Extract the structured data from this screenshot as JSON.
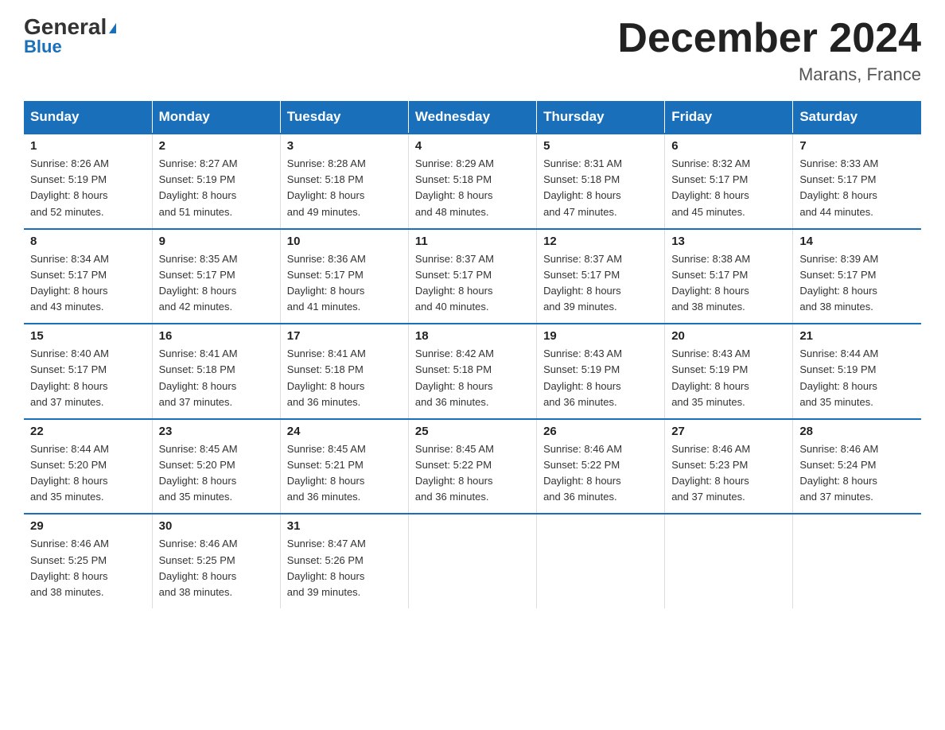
{
  "header": {
    "logo_line1": "General",
    "logo_line2": "Blue",
    "month_title": "December 2024",
    "location": "Marans, France"
  },
  "weekdays": [
    "Sunday",
    "Monday",
    "Tuesday",
    "Wednesday",
    "Thursday",
    "Friday",
    "Saturday"
  ],
  "weeks": [
    [
      {
        "day": "1",
        "sunrise": "Sunrise: 8:26 AM",
        "sunset": "Sunset: 5:19 PM",
        "daylight": "Daylight: 8 hours",
        "daylight2": "and 52 minutes."
      },
      {
        "day": "2",
        "sunrise": "Sunrise: 8:27 AM",
        "sunset": "Sunset: 5:19 PM",
        "daylight": "Daylight: 8 hours",
        "daylight2": "and 51 minutes."
      },
      {
        "day": "3",
        "sunrise": "Sunrise: 8:28 AM",
        "sunset": "Sunset: 5:18 PM",
        "daylight": "Daylight: 8 hours",
        "daylight2": "and 49 minutes."
      },
      {
        "day": "4",
        "sunrise": "Sunrise: 8:29 AM",
        "sunset": "Sunset: 5:18 PM",
        "daylight": "Daylight: 8 hours",
        "daylight2": "and 48 minutes."
      },
      {
        "day": "5",
        "sunrise": "Sunrise: 8:31 AM",
        "sunset": "Sunset: 5:18 PM",
        "daylight": "Daylight: 8 hours",
        "daylight2": "and 47 minutes."
      },
      {
        "day": "6",
        "sunrise": "Sunrise: 8:32 AM",
        "sunset": "Sunset: 5:17 PM",
        "daylight": "Daylight: 8 hours",
        "daylight2": "and 45 minutes."
      },
      {
        "day": "7",
        "sunrise": "Sunrise: 8:33 AM",
        "sunset": "Sunset: 5:17 PM",
        "daylight": "Daylight: 8 hours",
        "daylight2": "and 44 minutes."
      }
    ],
    [
      {
        "day": "8",
        "sunrise": "Sunrise: 8:34 AM",
        "sunset": "Sunset: 5:17 PM",
        "daylight": "Daylight: 8 hours",
        "daylight2": "and 43 minutes."
      },
      {
        "day": "9",
        "sunrise": "Sunrise: 8:35 AM",
        "sunset": "Sunset: 5:17 PM",
        "daylight": "Daylight: 8 hours",
        "daylight2": "and 42 minutes."
      },
      {
        "day": "10",
        "sunrise": "Sunrise: 8:36 AM",
        "sunset": "Sunset: 5:17 PM",
        "daylight": "Daylight: 8 hours",
        "daylight2": "and 41 minutes."
      },
      {
        "day": "11",
        "sunrise": "Sunrise: 8:37 AM",
        "sunset": "Sunset: 5:17 PM",
        "daylight": "Daylight: 8 hours",
        "daylight2": "and 40 minutes."
      },
      {
        "day": "12",
        "sunrise": "Sunrise: 8:37 AM",
        "sunset": "Sunset: 5:17 PM",
        "daylight": "Daylight: 8 hours",
        "daylight2": "and 39 minutes."
      },
      {
        "day": "13",
        "sunrise": "Sunrise: 8:38 AM",
        "sunset": "Sunset: 5:17 PM",
        "daylight": "Daylight: 8 hours",
        "daylight2": "and 38 minutes."
      },
      {
        "day": "14",
        "sunrise": "Sunrise: 8:39 AM",
        "sunset": "Sunset: 5:17 PM",
        "daylight": "Daylight: 8 hours",
        "daylight2": "and 38 minutes."
      }
    ],
    [
      {
        "day": "15",
        "sunrise": "Sunrise: 8:40 AM",
        "sunset": "Sunset: 5:17 PM",
        "daylight": "Daylight: 8 hours",
        "daylight2": "and 37 minutes."
      },
      {
        "day": "16",
        "sunrise": "Sunrise: 8:41 AM",
        "sunset": "Sunset: 5:18 PM",
        "daylight": "Daylight: 8 hours",
        "daylight2": "and 37 minutes."
      },
      {
        "day": "17",
        "sunrise": "Sunrise: 8:41 AM",
        "sunset": "Sunset: 5:18 PM",
        "daylight": "Daylight: 8 hours",
        "daylight2": "and 36 minutes."
      },
      {
        "day": "18",
        "sunrise": "Sunrise: 8:42 AM",
        "sunset": "Sunset: 5:18 PM",
        "daylight": "Daylight: 8 hours",
        "daylight2": "and 36 minutes."
      },
      {
        "day": "19",
        "sunrise": "Sunrise: 8:43 AM",
        "sunset": "Sunset: 5:19 PM",
        "daylight": "Daylight: 8 hours",
        "daylight2": "and 36 minutes."
      },
      {
        "day": "20",
        "sunrise": "Sunrise: 8:43 AM",
        "sunset": "Sunset: 5:19 PM",
        "daylight": "Daylight: 8 hours",
        "daylight2": "and 35 minutes."
      },
      {
        "day": "21",
        "sunrise": "Sunrise: 8:44 AM",
        "sunset": "Sunset: 5:19 PM",
        "daylight": "Daylight: 8 hours",
        "daylight2": "and 35 minutes."
      }
    ],
    [
      {
        "day": "22",
        "sunrise": "Sunrise: 8:44 AM",
        "sunset": "Sunset: 5:20 PM",
        "daylight": "Daylight: 8 hours",
        "daylight2": "and 35 minutes."
      },
      {
        "day": "23",
        "sunrise": "Sunrise: 8:45 AM",
        "sunset": "Sunset: 5:20 PM",
        "daylight": "Daylight: 8 hours",
        "daylight2": "and 35 minutes."
      },
      {
        "day": "24",
        "sunrise": "Sunrise: 8:45 AM",
        "sunset": "Sunset: 5:21 PM",
        "daylight": "Daylight: 8 hours",
        "daylight2": "and 36 minutes."
      },
      {
        "day": "25",
        "sunrise": "Sunrise: 8:45 AM",
        "sunset": "Sunset: 5:22 PM",
        "daylight": "Daylight: 8 hours",
        "daylight2": "and 36 minutes."
      },
      {
        "day": "26",
        "sunrise": "Sunrise: 8:46 AM",
        "sunset": "Sunset: 5:22 PM",
        "daylight": "Daylight: 8 hours",
        "daylight2": "and 36 minutes."
      },
      {
        "day": "27",
        "sunrise": "Sunrise: 8:46 AM",
        "sunset": "Sunset: 5:23 PM",
        "daylight": "Daylight: 8 hours",
        "daylight2": "and 37 minutes."
      },
      {
        "day": "28",
        "sunrise": "Sunrise: 8:46 AM",
        "sunset": "Sunset: 5:24 PM",
        "daylight": "Daylight: 8 hours",
        "daylight2": "and 37 minutes."
      }
    ],
    [
      {
        "day": "29",
        "sunrise": "Sunrise: 8:46 AM",
        "sunset": "Sunset: 5:25 PM",
        "daylight": "Daylight: 8 hours",
        "daylight2": "and 38 minutes."
      },
      {
        "day": "30",
        "sunrise": "Sunrise: 8:46 AM",
        "sunset": "Sunset: 5:25 PM",
        "daylight": "Daylight: 8 hours",
        "daylight2": "and 38 minutes."
      },
      {
        "day": "31",
        "sunrise": "Sunrise: 8:47 AM",
        "sunset": "Sunset: 5:26 PM",
        "daylight": "Daylight: 8 hours",
        "daylight2": "and 39 minutes."
      },
      {
        "day": "",
        "sunrise": "",
        "sunset": "",
        "daylight": "",
        "daylight2": ""
      },
      {
        "day": "",
        "sunrise": "",
        "sunset": "",
        "daylight": "",
        "daylight2": ""
      },
      {
        "day": "",
        "sunrise": "",
        "sunset": "",
        "daylight": "",
        "daylight2": ""
      },
      {
        "day": "",
        "sunrise": "",
        "sunset": "",
        "daylight": "",
        "daylight2": ""
      }
    ]
  ]
}
